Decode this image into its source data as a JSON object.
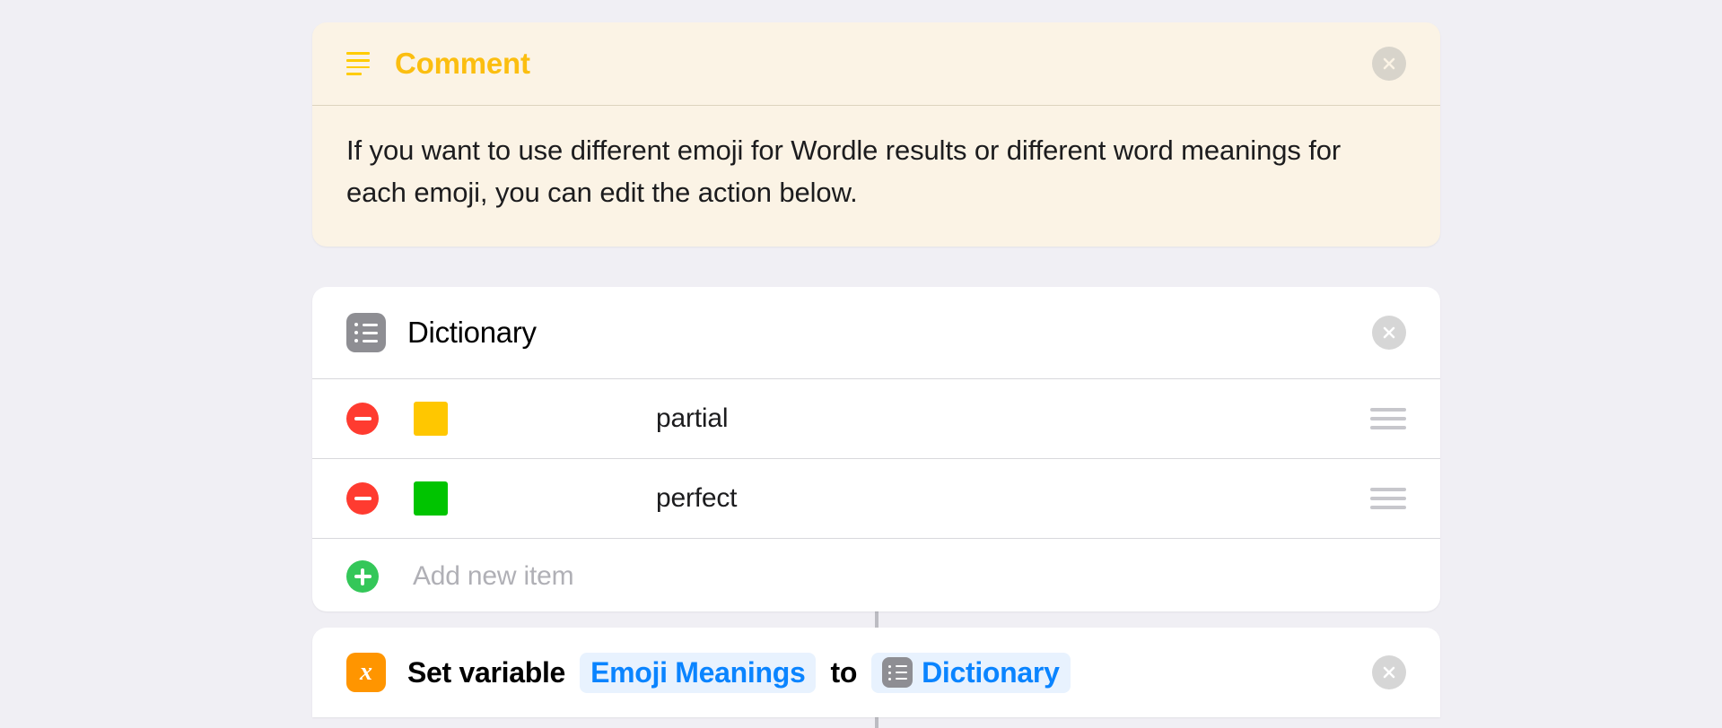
{
  "app": {
    "background_color": "#F0EFF4",
    "connector_color": "#BCBCC2"
  },
  "comment_action": {
    "icon": "comment-lines-icon",
    "title": "Comment",
    "title_color": "#FBBE10",
    "background_color": "#FBF3E5",
    "body_text": "If you want to use different emoji for Wordle results or different word meanings for each emoji, you can edit the action below.",
    "close_label": "×"
  },
  "dictionary_action": {
    "icon": "list-bullets-icon",
    "title": "Dictionary",
    "close_label": "×",
    "rows": [
      {
        "remove_label": "−",
        "emoji_name": "yellow-square-emoji",
        "emoji_color": "#FFC700",
        "key": "partial",
        "drag_label": "reorder"
      },
      {
        "remove_label": "−",
        "emoji_name": "green-square-emoji",
        "emoji_color": "#00C400",
        "key": "perfect",
        "drag_label": "reorder"
      }
    ],
    "add_row": {
      "add_label": "+",
      "placeholder": "Add new item"
    }
  },
  "set_variable_action": {
    "icon_glyph": "x",
    "icon_color": "#FF9500",
    "label_prefix": "Set variable",
    "variable_token": "Emoji Meanings",
    "connector_word": "to",
    "value_token": "Dictionary",
    "value_token_icon": "list-bullets-icon",
    "token_color": "#0A84FF",
    "token_background": "#E8F2FE",
    "close_label": "×"
  }
}
